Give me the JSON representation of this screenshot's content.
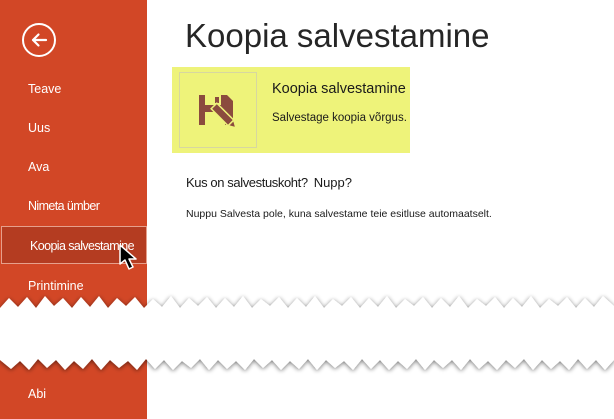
{
  "sidebar": {
    "back_icon": "arrow-left-circle-icon",
    "items": [
      {
        "label": "Teave"
      },
      {
        "label": "Uus"
      },
      {
        "label": "Ava"
      },
      {
        "label": "Nimeta ümber"
      },
      {
        "label": "Koopia salvestamine",
        "active": true
      },
      {
        "label": "Printimine"
      },
      {
        "label": "Abi"
      }
    ]
  },
  "main": {
    "title": "Koopia salvestamine",
    "option": {
      "icon": "floppy-disk-pencil-icon",
      "title": "Koopia salvestamine",
      "description": "Salvestage koopia võrgus."
    },
    "question": "Kus on salvestuskoht?",
    "question_extra": "Nupp?",
    "info": "Nuppu Salvesta pole, kuna salvestame teie esitluse automaatselt."
  },
  "colors": {
    "sidebar_bg": "#d24726",
    "active_item_bg": "#b43c21",
    "highlight": "#eef37a",
    "icon_color": "#8b4b3e"
  }
}
